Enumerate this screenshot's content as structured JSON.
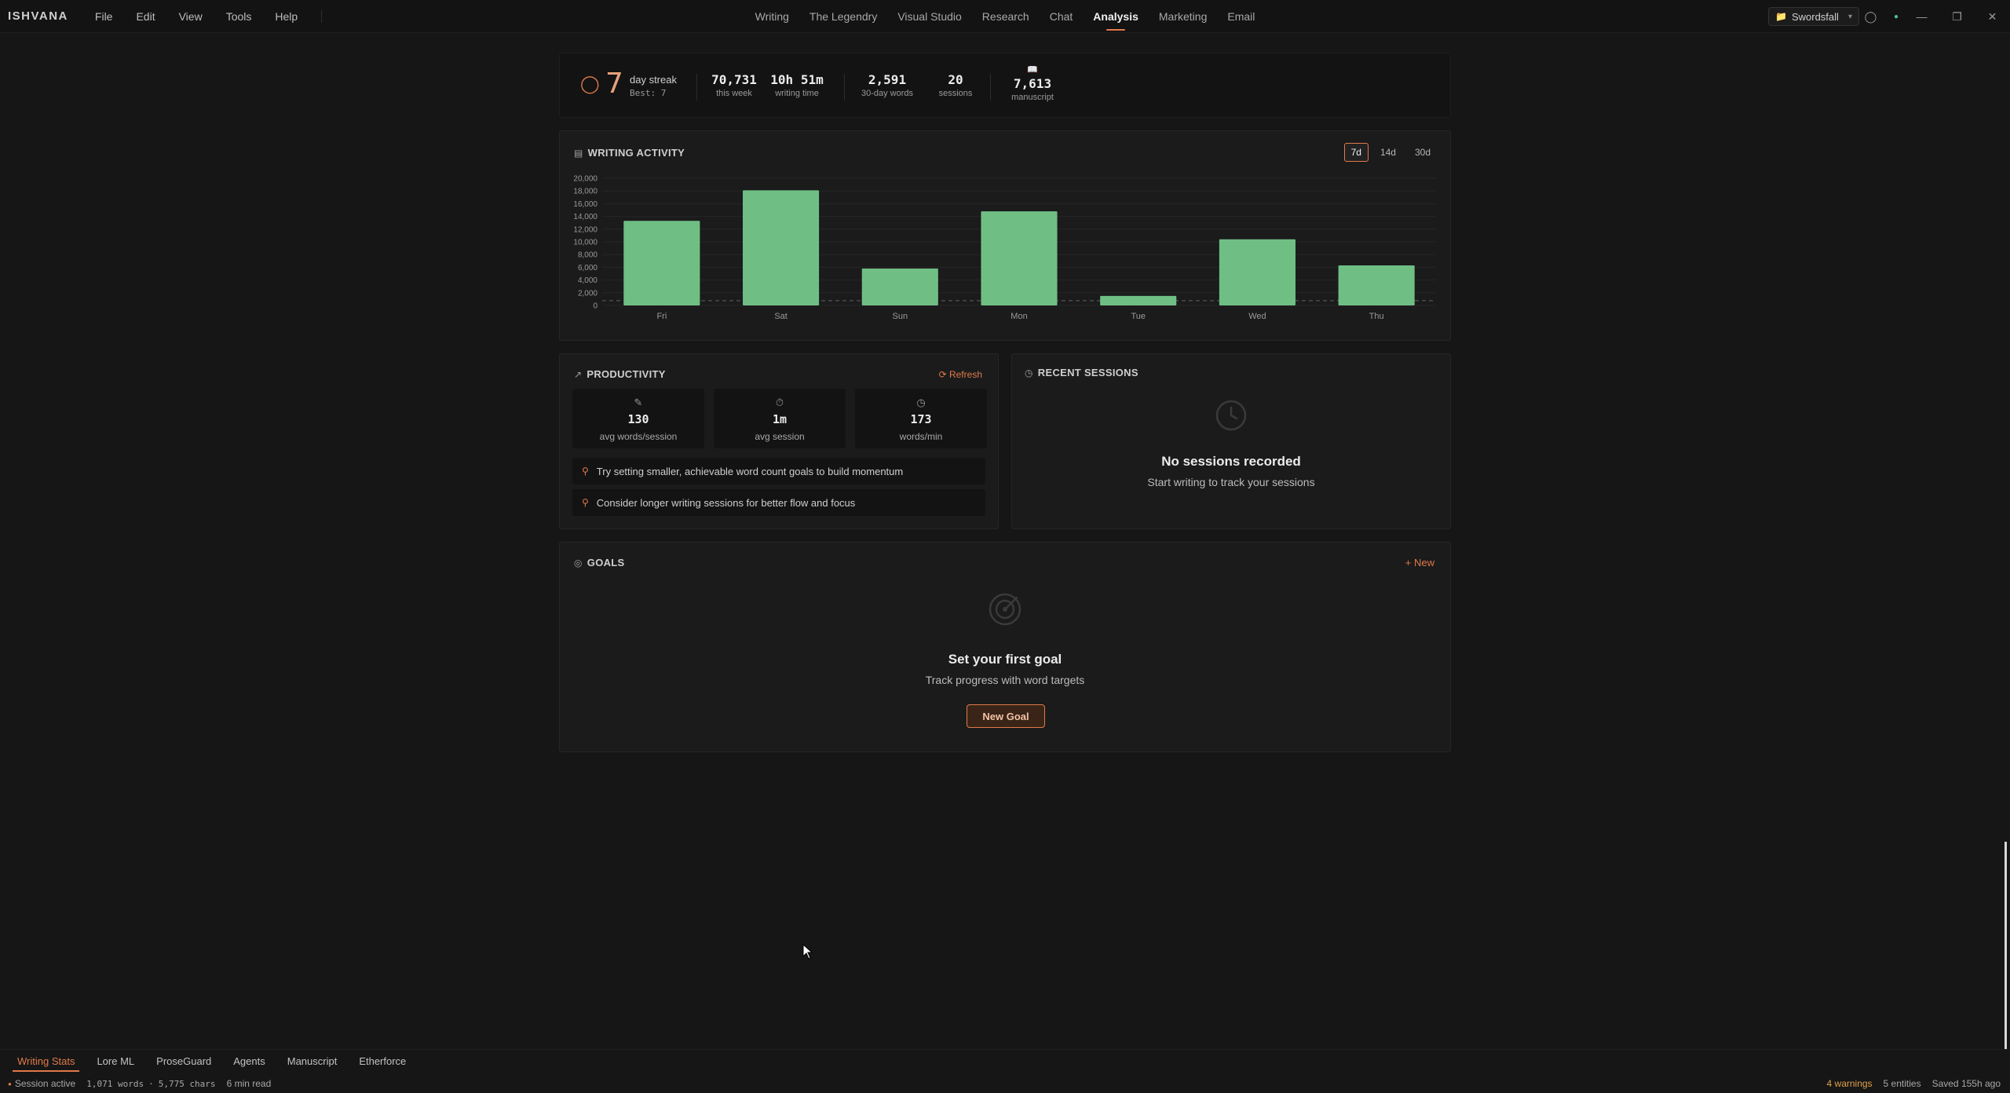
{
  "app": {
    "brand": "ISHVANA",
    "menu": [
      "File",
      "Edit",
      "View",
      "Tools",
      "Help"
    ],
    "nav": [
      "Writing",
      "The Legendry",
      "Visual Studio",
      "Research",
      "Chat",
      "Analysis",
      "Marketing",
      "Email"
    ],
    "active_nav": "Analysis",
    "workspace": "Swordsfall"
  },
  "stats": {
    "streak": "7",
    "streak_label": "day streak",
    "best": "Best: 7",
    "this_week": "70,731",
    "this_week_label": "this week",
    "writing_time": "10h 51m",
    "writing_time_label": "writing time",
    "words_30d": "2,591",
    "words_30d_label": "30-day words",
    "sessions": "20",
    "sessions_label": "sessions",
    "manuscript": "7,613",
    "manuscript_label": "manuscript"
  },
  "activity": {
    "title": "WRITING ACTIVITY",
    "ranges": [
      "7d",
      "14d",
      "30d"
    ],
    "active_range": "7d"
  },
  "chart_data": {
    "type": "bar",
    "categories": [
      "Fri",
      "Sat",
      "Sun",
      "Mon",
      "Tue",
      "Wed",
      "Thu"
    ],
    "values": [
      13300,
      18100,
      5800,
      14800,
      1500,
      10400,
      6300
    ],
    "goal_line": 500,
    "ylim": [
      0,
      20000
    ],
    "yticks": [
      "0",
      "2,000",
      "4,000",
      "6,000",
      "8,000",
      "10,000",
      "12,000",
      "14,000",
      "16,000",
      "18,000",
      "20,000"
    ],
    "grid": true,
    "colors": {
      "bar": "#6fbf85",
      "grid": "#262626"
    }
  },
  "productivity": {
    "title": "PRODUCTIVITY",
    "refresh": "Refresh",
    "cards": [
      {
        "value": "130",
        "label": "avg words/session"
      },
      {
        "value": "1m",
        "label": "avg session"
      },
      {
        "value": "173",
        "label": "words/min"
      }
    ],
    "tips": [
      "Try setting smaller, achievable word count goals to build momentum",
      "Consider longer writing sessions for better flow and focus"
    ]
  },
  "sessions": {
    "title": "RECENT SESSIONS",
    "empty_title": "No sessions recorded",
    "empty_sub": "Start writing to track your sessions"
  },
  "goals": {
    "title": "GOALS",
    "new_link": "New",
    "empty_title": "Set your first goal",
    "empty_sub": "Track progress with word targets",
    "new_goal_button": "New Goal"
  },
  "bottom_tabs": [
    "Writing Stats",
    "Lore ML",
    "ProseGuard",
    "Agents",
    "Manuscript",
    "Etherforce"
  ],
  "active_bottom_tab": "Writing Stats",
  "status": {
    "session": "Session active",
    "words": "1,071 words",
    "chars": "5,775 chars",
    "read": "6 min read",
    "warnings": "4 warnings",
    "entities": "5 entities",
    "saved": "Saved 155h ago"
  },
  "accent": "#e07a4a"
}
